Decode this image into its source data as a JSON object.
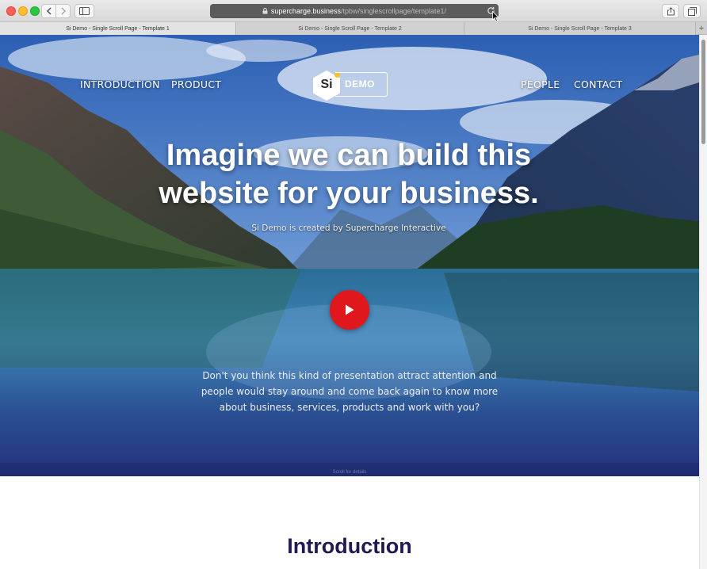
{
  "browser": {
    "url_domain": "supercharge.business",
    "url_path": "/tpbw/singlescrollpage/template1/",
    "tabs": [
      {
        "label": "Si Demo - Single Scroll Page - Template 1"
      },
      {
        "label": "Si Demo - Single Scroll Page - Template 2"
      },
      {
        "label": "Si Demo - Single Scroll Page - Template 3"
      }
    ],
    "new_tab_label": "+"
  },
  "hero": {
    "nav": {
      "introduction": "INTRODUCTION",
      "product": "PRODUCT",
      "people": "PEOPLE",
      "contact": "CONTACT"
    },
    "logo": {
      "mark": "Si",
      "text": "DEMO"
    },
    "title_line1": "Imagine we can build this",
    "title_line2": "website for your business.",
    "subtitle": "Si Demo is created by Supercharge Interactive",
    "body_line1": "Don't you think this kind of presentation attract attention and",
    "body_line2": "people would stay around and come back again to know more",
    "body_line3": "about business, services, products and work with you?",
    "scroll_hint": "Scroll for details"
  },
  "content": {
    "section_title": "Introduction"
  },
  "colors": {
    "play_button": "#e0181e",
    "logo_accent": "#f4c22b",
    "section_title": "#1f1b52"
  }
}
